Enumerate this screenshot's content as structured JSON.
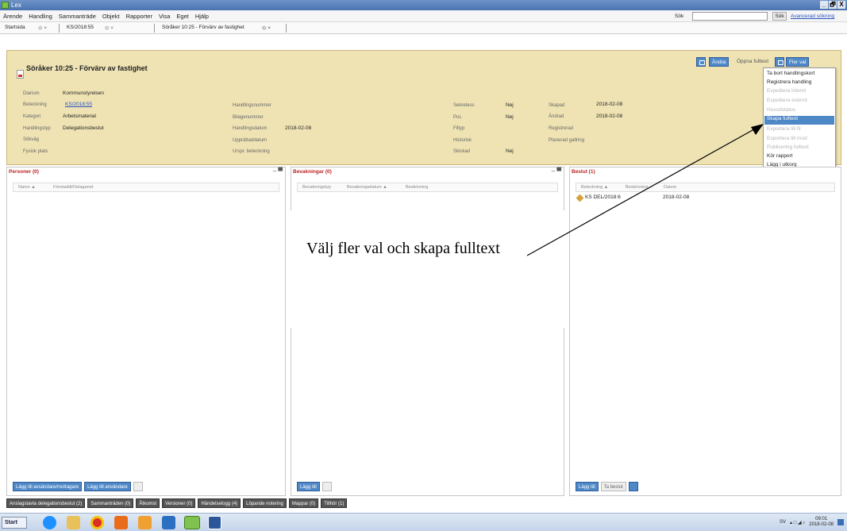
{
  "window": {
    "title": "Lex",
    "controls": [
      "_",
      "И",
      "X"
    ]
  },
  "menu": {
    "items": [
      "Ärende",
      "Handling",
      "Sammanträde",
      "Objekt",
      "Rapporter",
      "Visa",
      "Eget",
      "Hjälp"
    ],
    "search_label": "Sök",
    "search_value": "",
    "search_button": "Sök",
    "advanced_link": "Avancerad sökning"
  },
  "tabs": [
    {
      "label": "Startsida",
      "close": "⊙ ×"
    },
    {
      "label": "KS/2018:55",
      "close": "⊙ ×"
    },
    {
      "label": "Söråker 10:25 - Förvärv av fastighet",
      "close": "⊙ ×"
    }
  ],
  "header": {
    "title": "Söråker 10:25 - Förvärv av fastighet",
    "buttons": {
      "refresh_icon": "refresh-icon",
      "edit": "Ändra",
      "open_fulltext": "Öppna fulltext",
      "more": "Fler val"
    },
    "fields": [
      {
        "label": "Diarium",
        "value": "Kommunstyrelsen"
      },
      {
        "label": "Beteckning",
        "value": "KS/2018:55"
      },
      {
        "label": "Kategori",
        "value": "Arbetsmaterial"
      },
      {
        "label": "Handlingstyp",
        "value": "Delegationsbeslut"
      },
      {
        "label": "Sökväg",
        "value": ""
      },
      {
        "label": "Fysisk plats",
        "value": ""
      },
      {
        "label": "Handlingsnummer",
        "value": ""
      },
      {
        "label": "Bilagenummer",
        "value": ""
      },
      {
        "label": "Handlingsdatum",
        "value": "2018-02-08"
      },
      {
        "label": "Upprättaddatum",
        "value": ""
      },
      {
        "label": "Urspr. beteckning",
        "value": ""
      },
      {
        "label": "Sekretess",
        "value": "Nej"
      },
      {
        "label": "PuL",
        "value": "Nej"
      },
      {
        "label": "Filtyp",
        "value": ""
      },
      {
        "label": "Historisk",
        "value": ""
      },
      {
        "label": "Skickad",
        "value": "Nej"
      },
      {
        "label": "Skapad",
        "value": "2018-02-08"
      },
      {
        "label": "Ändrad",
        "value": "2018-02-08"
      },
      {
        "label": "Registrerad",
        "value": ""
      },
      {
        "label": "Planerad gallring",
        "value": ""
      }
    ]
  },
  "dropdown": {
    "items": [
      {
        "label": "Ta bort handlingskort",
        "state": "enabled"
      },
      {
        "label": "Registrera handling",
        "state": "enabled"
      },
      {
        "label": "Expediera internt",
        "state": "disabled"
      },
      {
        "label": "Expediera externt",
        "state": "disabled"
      },
      {
        "label": "Huvudstatus",
        "state": "disabled"
      },
      {
        "label": "Skapa fulltext",
        "state": "selected"
      },
      {
        "label": "Exportera till fil",
        "state": "disabled"
      },
      {
        "label": "Exportera till mod",
        "state": "disabled"
      },
      {
        "label": "Publicering fulltext",
        "state": "disabled"
      },
      {
        "label": "Kör rapport",
        "state": "enabled"
      },
      {
        "label": "Lägg i utkorg",
        "state": "enabled"
      }
    ]
  },
  "panels": {
    "persons": {
      "title": "Personer (0)",
      "controls": "– ▀",
      "columns": [
        "Namn ▲",
        "Företaddt/Delagarnd"
      ],
      "buttons": [
        "Lägg till avsändare/mottagare",
        "Lägg till användare"
      ]
    },
    "reminders": {
      "title": "Bevakningar (0)",
      "controls": "– ▀",
      "columns": [
        "Bevakningstyp",
        "Bevakningsdatum ▲",
        "Beskrivning"
      ],
      "buttons": [
        "Lägg till"
      ]
    },
    "decisions": {
      "title": "Beslut (1)",
      "columns": [
        "Beteckning ▲",
        "Beskrivning",
        "Datum"
      ],
      "rows": [
        {
          "designation": "KS DEL/2018:6",
          "date": "2018-02-08"
        }
      ],
      "buttons": [
        "Lägg till",
        "Ta beslut"
      ]
    }
  },
  "annotation": {
    "text": "Välj fler val och skapa fulltext"
  },
  "bottom_tabs": [
    "Anslagstavla delegationsbeslut (2)",
    "Sammanträden (0)",
    "Åtkomst",
    "Versioner (0)",
    "Händelselogg (4)",
    "Löpande notering",
    "Mappar (0)",
    "Tillhör (1)"
  ],
  "taskbar": {
    "start_label": "Start",
    "icons": [
      "ie-icon",
      "folder-icon",
      "chrome-icon",
      "media-icon",
      "outlook-icon",
      "lync-icon",
      "lex-icon",
      "word-icon"
    ],
    "language": "SV",
    "time": "09:01",
    "date": "2018-02-08",
    "colors": {
      "ie": "#1e90ff",
      "folder": "#e8c15a",
      "chrome": "#d93025",
      "media": "#e86c1a",
      "outlook": "#f0a030",
      "lync": "#2b6fc2",
      "lex": "#7fc24e",
      "word": "#2b579a"
    }
  }
}
